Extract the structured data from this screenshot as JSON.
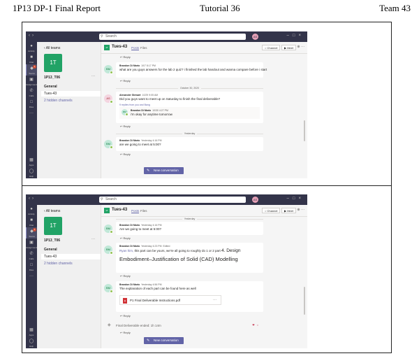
{
  "report": {
    "left": "1P13 DP-1 Final Report",
    "center": "Tutorial 36",
    "right": "Team 43"
  },
  "ui": {
    "search_placeholder": "Search",
    "user_initials": "AS",
    "all_teams": "All teams",
    "team_logo": "1T",
    "team_name": "1P13_T06",
    "more": "···",
    "general": "General",
    "channel": "Tues-43",
    "hidden_channels": "2 hidden channels",
    "channel_title": "Tues-43",
    "tab_posts": "Posts",
    "tab_files": "Files",
    "channel_btn": "Channel",
    "meet_btn": "Meet",
    "new_conversation": "New conversation",
    "reply": "Reply",
    "rail": [
      "Activity",
      "Chat",
      "Teams",
      "Assignments",
      "Calls",
      "Files"
    ],
    "rail_bottom": [
      "Apps",
      "Help"
    ],
    "teams_badge": "1"
  },
  "s1": {
    "m1": {
      "initials": "BM",
      "author": "Brandon Di Mario",
      "time": "10/7 8:17 PM",
      "text": "what are you guys answers for the lab 2 quiz? i finished the lab handout and wanna compare before i start"
    },
    "date1": "October 30, 2020",
    "m2": {
      "initials": "AS",
      "author": "Alexander Stewart",
      "time": "10/29 9:05 AM",
      "text": "Did you guys want to meet up on Saturday to finish the final deliverable?"
    },
    "see_more": "9 replies from you and Bang",
    "m2r": {
      "initials": "BM",
      "author": "Brandon Di Mario",
      "time": "10/30 4:27 PM",
      "text": "i'm okay for anytime tomorrow"
    },
    "date2": "Yesterday",
    "m3": {
      "initials": "BM",
      "author": "Brandon Di Mario",
      "time": "Yesterday 4:16 PM",
      "text": "are we going to meet at 5:00?"
    }
  },
  "s2": {
    "top_label": "Yesterday",
    "m1": {
      "initials": "BM",
      "author": "Brandon Di Mario",
      "time": "Yesterday 4:16 PM",
      "text": "Are we going to meet at 5:00?"
    },
    "m2": {
      "initials": "BM",
      "author": "Brandon Di Mario",
      "time": "Yesterday 4:23 PM",
      "edited": "Edited",
      "mention": "Ryan him,",
      "text_pre": "this part can be yours, we're all going to roughly do 1 or 2 part",
      "heading1": "4. Design",
      "heading2": "Embodiment–Justification of Solid (CAD) Modelling"
    },
    "m3": {
      "initials": "BM",
      "author": "Brandon Di Mario",
      "time": "Yesterday 4:56 PM",
      "text": "The explanation of each part can be found here as well",
      "file": "P1 Final Deliverable Instructions.pdf"
    },
    "event": "Final Deliverable ended: 1h 14m"
  }
}
